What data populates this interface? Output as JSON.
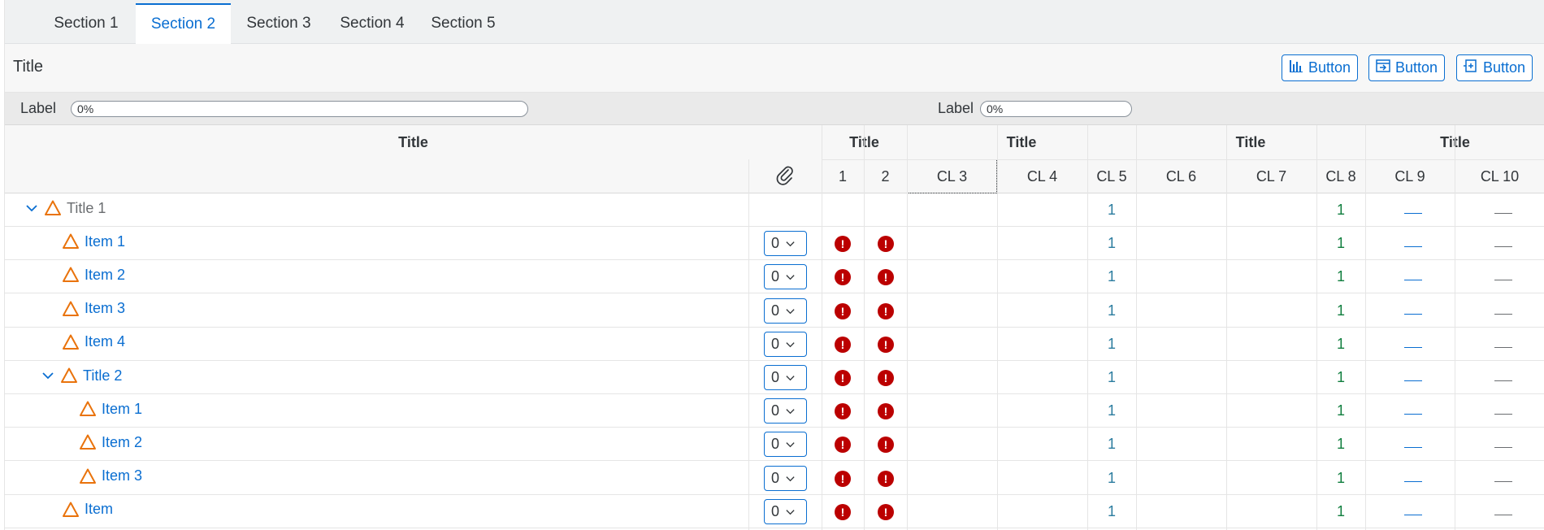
{
  "tabs": [
    "Section 1",
    "Section 2",
    "Section 3",
    "Section 4",
    "Section 5"
  ],
  "active_tab": "Section 2",
  "page_title": "Title",
  "toolbar": {
    "buttons": [
      {
        "label": "Button",
        "icon": "column-chart-icon"
      },
      {
        "label": "Button",
        "icon": "calendar-export-icon"
      },
      {
        "label": "Button",
        "icon": "add-item-icon"
      }
    ]
  },
  "label_bar": {
    "left": {
      "label": "Label",
      "progress_text": "0%",
      "progress": 0
    },
    "right": {
      "label": "Label",
      "progress_text": "0%",
      "progress": 0
    }
  },
  "table": {
    "group_headers": [
      "Title",
      "Title",
      "Title",
      "Title",
      "Title"
    ],
    "column_headers": [
      "1",
      "2",
      "CL 3",
      "CL 4",
      "CL 5",
      "CL 6",
      "CL 7",
      "CL 8",
      "CL 9",
      "CL 10"
    ],
    "attachment_icon": "paperclip-icon",
    "rows": [
      {
        "title": "Title 1",
        "level": 0,
        "expandable": true,
        "style": "grey",
        "select": null,
        "cl5": "1",
        "cl8": "1"
      },
      {
        "title": "Item 1",
        "level": 1,
        "expandable": false,
        "style": "link",
        "select": "0",
        "cl5": "1",
        "cl8": "1"
      },
      {
        "title": "Item 2",
        "level": 1,
        "expandable": false,
        "style": "link",
        "select": "0",
        "cl5": "1",
        "cl8": "1"
      },
      {
        "title": "Item 3",
        "level": 1,
        "expandable": false,
        "style": "link",
        "select": "0",
        "cl5": "1",
        "cl8": "1"
      },
      {
        "title": "Item 4",
        "level": 1,
        "expandable": false,
        "style": "link",
        "select": "0",
        "cl5": "1",
        "cl8": "1"
      },
      {
        "title": "Title 2",
        "level": 1,
        "expandable": true,
        "style": "link",
        "select": "0",
        "cl5": "1",
        "cl8": "1"
      },
      {
        "title": "Item 1",
        "level": 2,
        "expandable": false,
        "style": "link",
        "select": "0",
        "cl5": "1",
        "cl8": "1"
      },
      {
        "title": "Item 2",
        "level": 2,
        "expandable": false,
        "style": "link",
        "select": "0",
        "cl5": "1",
        "cl8": "1"
      },
      {
        "title": "Item 3",
        "level": 2,
        "expandable": false,
        "style": "link",
        "select": "0",
        "cl5": "1",
        "cl8": "1"
      },
      {
        "title": "Item",
        "level": 1,
        "expandable": false,
        "style": "link",
        "select": "0",
        "cl5": "1",
        "cl8": "1"
      }
    ]
  },
  "colors": {
    "accent": "#0a6ed1",
    "error": "#bb0000",
    "warning": "#e9730c",
    "success": "#107e3e"
  }
}
